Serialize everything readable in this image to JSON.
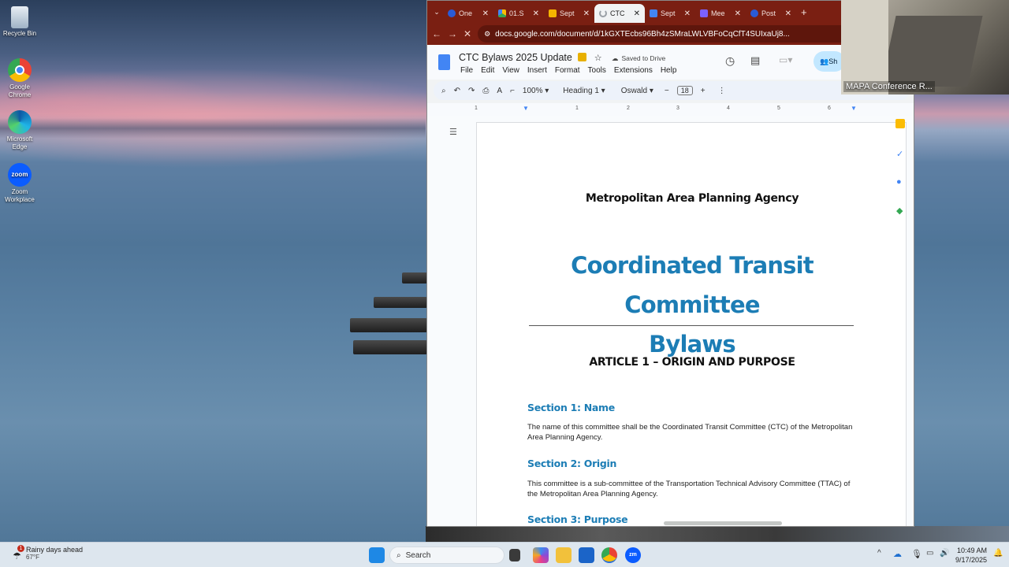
{
  "desktop": {
    "icons": [
      {
        "label": "Recycle Bin"
      },
      {
        "label": "Google Chrome"
      },
      {
        "label": "Microsoft Edge"
      },
      {
        "label": "Zoom Workplace"
      }
    ]
  },
  "browser": {
    "tabs": [
      {
        "label": "One",
        "color": "#2a5bd7"
      },
      {
        "label": "01.S",
        "color": "#fbbc04"
      },
      {
        "label": "Sept",
        "color": "#f4b400"
      },
      {
        "label": "CTC",
        "color": "#9aa0a6"
      },
      {
        "label": "Sept",
        "color": "#4285f4"
      },
      {
        "label": "Mee",
        "color": "#7b61ff"
      },
      {
        "label": "Post",
        "color": "#2a5bd7"
      }
    ],
    "new_tab": "+",
    "url": "docs.google.com/document/d/1kGXTEcbs96Bh4zSMraLWLVBFoCqCfT4SUIxaUj8..."
  },
  "docs": {
    "title": "CTC Bylaws 2025 Update",
    "saved_status": "Saved to Drive",
    "menu": [
      "File",
      "Edit",
      "View",
      "Insert",
      "Format",
      "Tools",
      "Extensions",
      "Help"
    ],
    "share_label": "Sh",
    "toolbar": {
      "zoom": "100%",
      "style": "Heading 1",
      "font": "Oswald",
      "font_size": "18"
    },
    "ruler": [
      "1",
      "1",
      "2",
      "3",
      "4",
      "5",
      "6"
    ],
    "content": {
      "agency": "Metropolitan Area Planning Agency",
      "title_line1": "Coordinated Transit Committee",
      "title_line2": "Bylaws",
      "article": "ARTICLE 1 – ORIGIN AND PURPOSE",
      "sections": [
        {
          "heading": "Section 1: Name",
          "body": "The name of this committee shall be the Coordinated Transit Committee (CTC) of the Metropolitan Area Planning Agency."
        },
        {
          "heading": "Section 2: Origin",
          "body": "This committee is a sub-committee of the Transportation Technical Advisory Committee (TTAC) of the Metropolitan Area Planning Agency."
        },
        {
          "heading": "Section 3: Purpose",
          "body": ""
        }
      ]
    }
  },
  "video": {
    "label": "MAPA Conference R..."
  },
  "taskbar": {
    "weather_title": "Rainy days ahead",
    "weather_temp": "67°F",
    "weather_badge": "1",
    "search_placeholder": "Search",
    "time": "10:49 AM",
    "date": "9/17/2025"
  }
}
